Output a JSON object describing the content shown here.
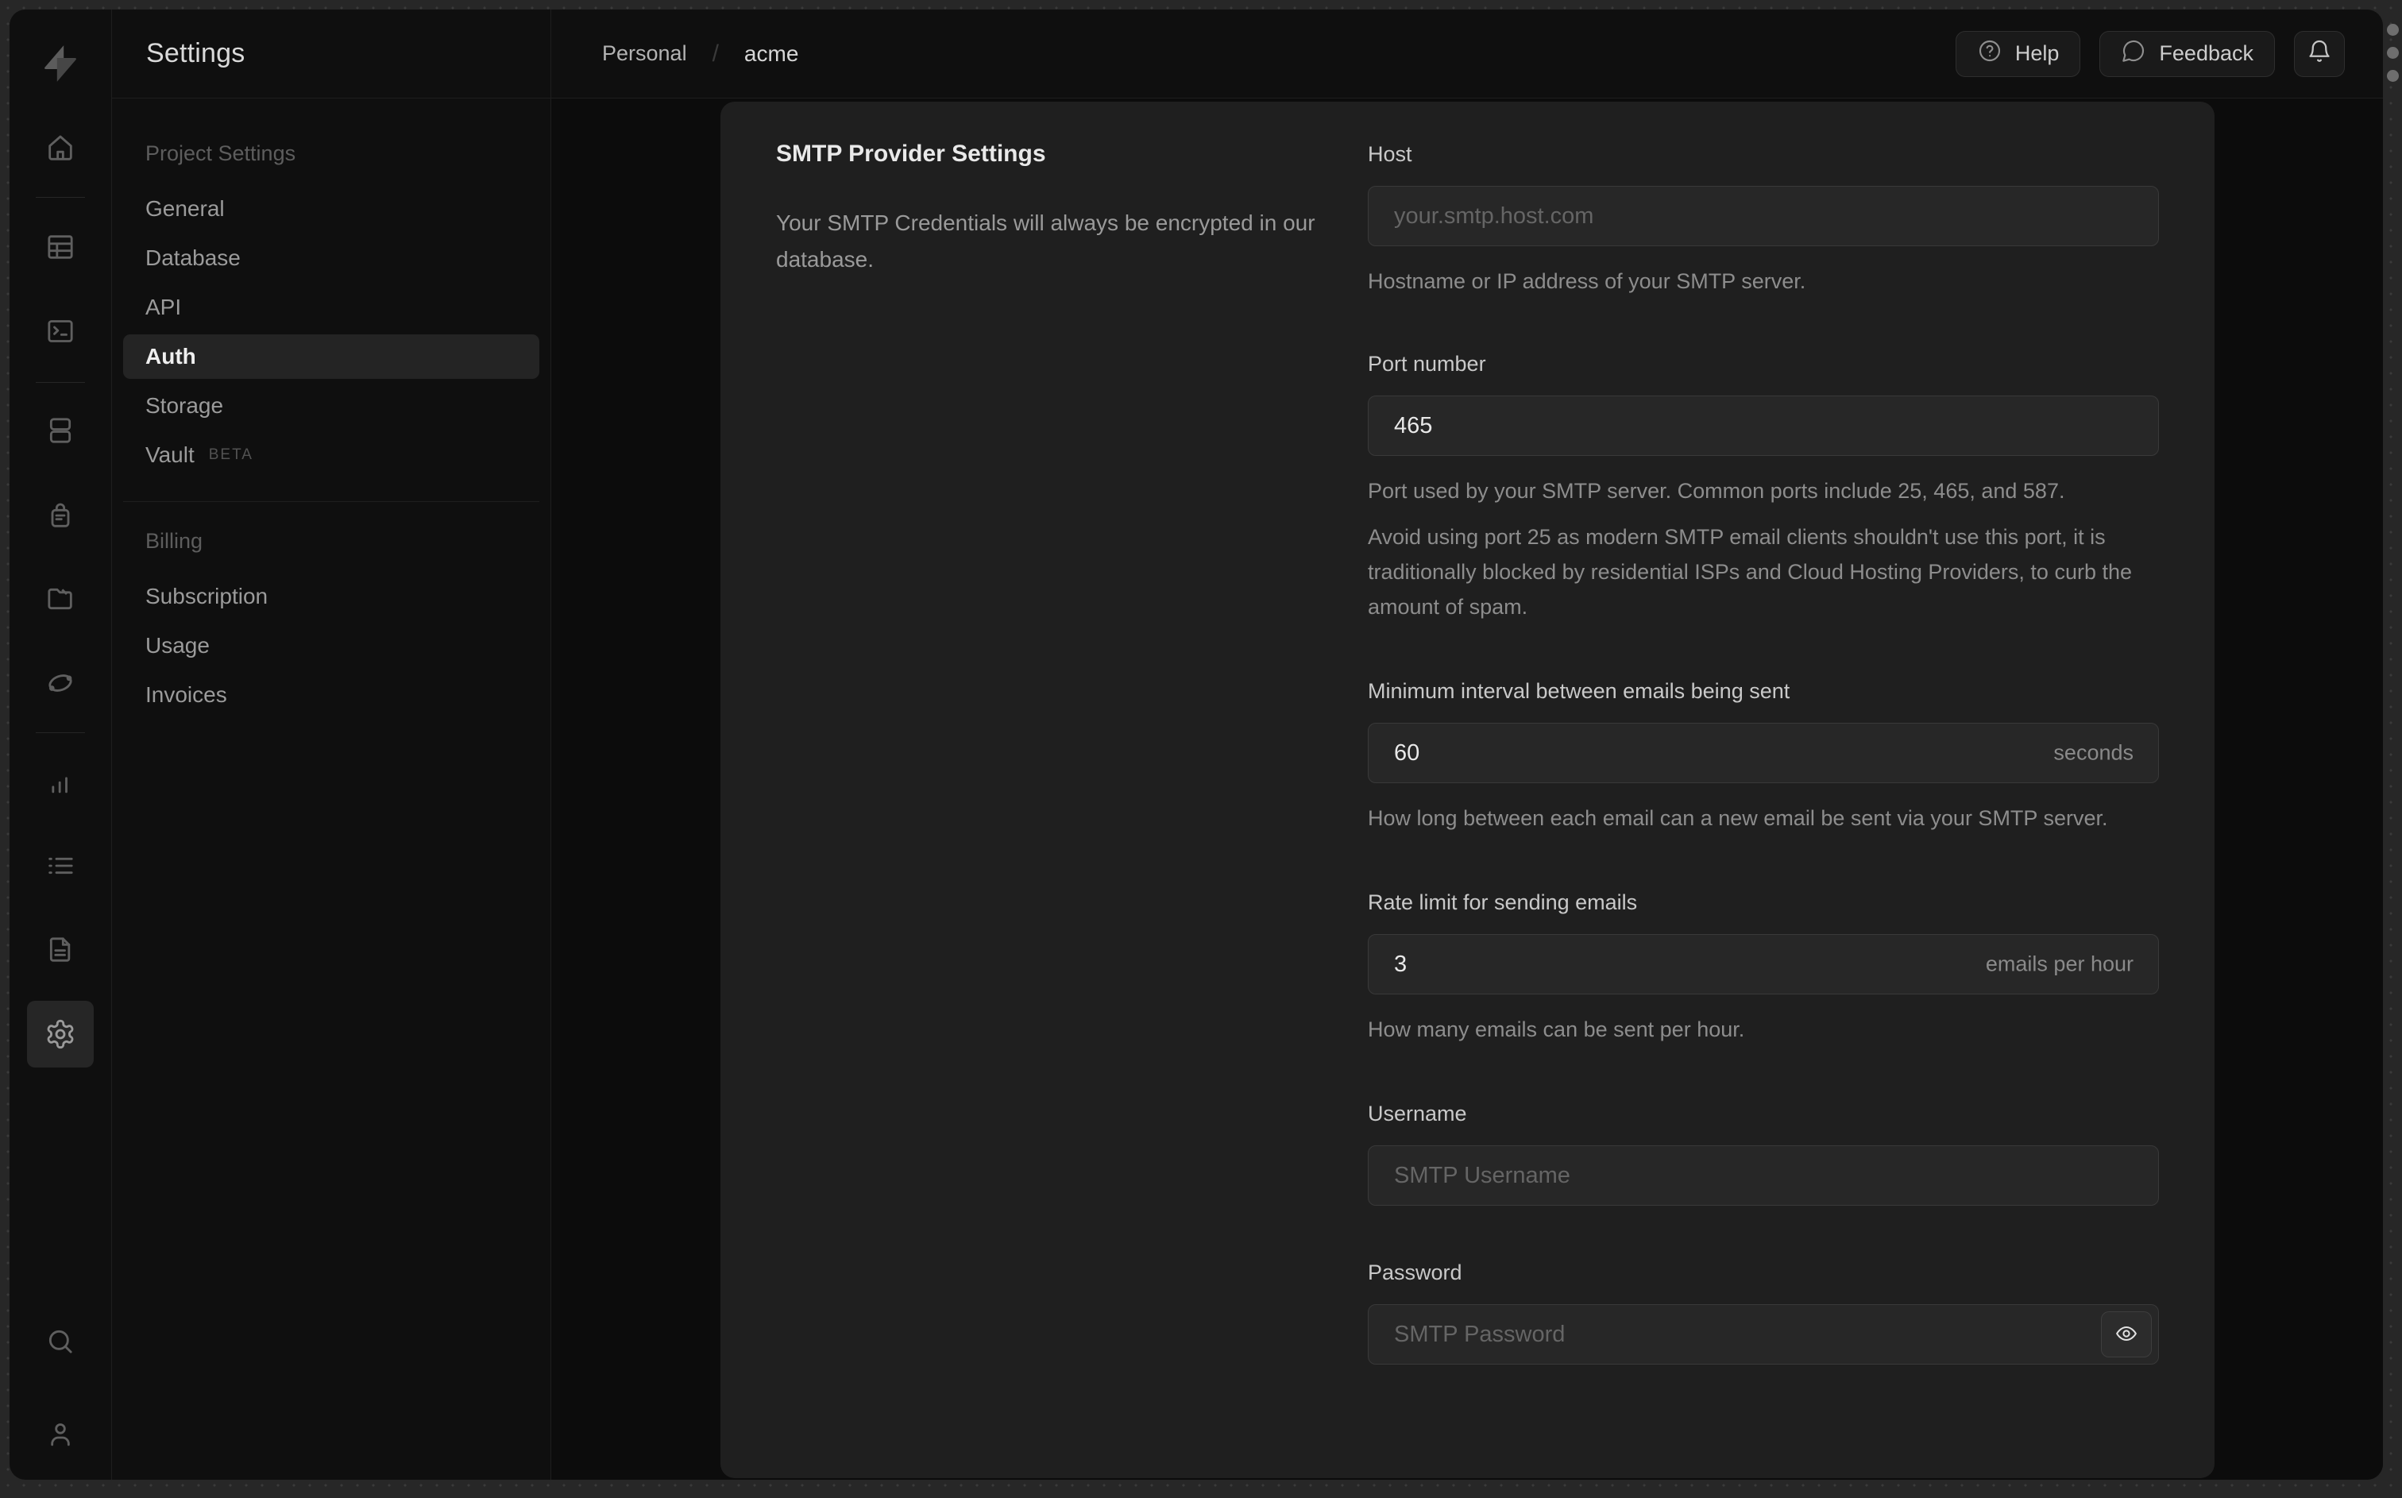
{
  "rail": {
    "logo_icon": "supabase-zap-logo",
    "icons": [
      "home",
      "table-editor",
      "sql-editor",
      "database",
      "auth",
      "storage",
      "edge-functions",
      "reports",
      "logs",
      "docs",
      "settings",
      "search",
      "user"
    ],
    "active_icon": "settings"
  },
  "sidebar": {
    "title": "Settings",
    "groups": [
      {
        "label": "Project Settings",
        "items": [
          {
            "label": "General"
          },
          {
            "label": "Database"
          },
          {
            "label": "API"
          },
          {
            "label": "Auth",
            "active": true
          },
          {
            "label": "Storage"
          },
          {
            "label": "Vault",
            "badge": "BETA"
          }
        ]
      },
      {
        "label": "Billing",
        "items": [
          {
            "label": "Subscription"
          },
          {
            "label": "Usage"
          },
          {
            "label": "Invoices"
          }
        ]
      }
    ]
  },
  "topbar": {
    "breadcrumb": {
      "org": "Personal",
      "separator": "/",
      "project": "acme"
    },
    "help_label": "Help",
    "feedback_label": "Feedback",
    "bell_icon": "notifications-bell"
  },
  "panel": {
    "title": "SMTP Provider Settings",
    "description": "Your SMTP Credentials will always be encrypted in our database.",
    "fields": {
      "host": {
        "label": "Host",
        "value": "",
        "placeholder": "your.smtp.host.com",
        "helper": "Hostname or IP address of your SMTP server."
      },
      "port": {
        "label": "Port number",
        "value": "465",
        "helper": "Port used by your SMTP server. Common ports include 25, 465, and 587.",
        "note": "Avoid using port 25 as modern SMTP email clients shouldn't use this port, it is traditionally blocked by residential ISPs and Cloud Hosting Providers, to curb the amount of spam."
      },
      "interval": {
        "label": "Minimum interval between emails being sent",
        "value": "60",
        "suffix": "seconds",
        "helper": "How long between each email can a new email be sent via your SMTP server."
      },
      "rate": {
        "label": "Rate limit for sending emails",
        "value": "3",
        "suffix": "emails per hour",
        "helper": "How many emails can be sent per hour."
      },
      "username": {
        "label": "Username",
        "value": "",
        "placeholder": "SMTP Username"
      },
      "password": {
        "label": "Password",
        "value": "",
        "placeholder": "SMTP Password"
      }
    }
  },
  "colors": {
    "desktop_bg": "#272727",
    "window_bg": "#0f0f0f",
    "card_bg": "#1f1f1f",
    "input_bg": "#272727",
    "border": "#1e1e1e",
    "text_primary": "#e9e9e9",
    "text_muted": "#8d8d8d"
  }
}
